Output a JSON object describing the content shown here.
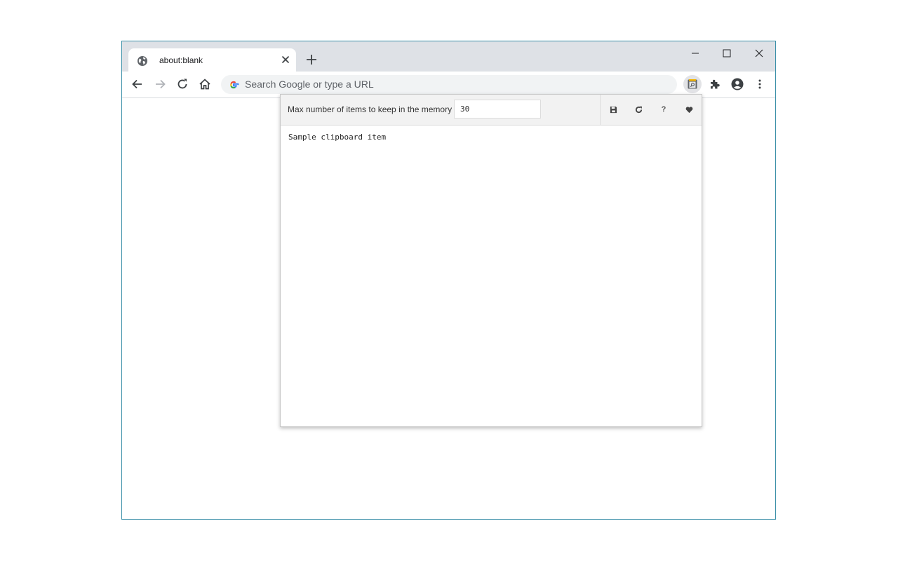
{
  "browser": {
    "tab": {
      "title": "about:blank"
    },
    "omnibox": {
      "placeholder": "Search Google or type a URL"
    }
  },
  "popup": {
    "max_items_label": "Max number of items to keep in the memory",
    "max_items_value": "30",
    "help_label": "?",
    "clipboard_items": [
      "Sample clipboard item"
    ]
  },
  "colors": {
    "titlebar": "#dee1e6",
    "omnibox": "#f1f3f4",
    "popup_header": "#f2f2f2"
  }
}
